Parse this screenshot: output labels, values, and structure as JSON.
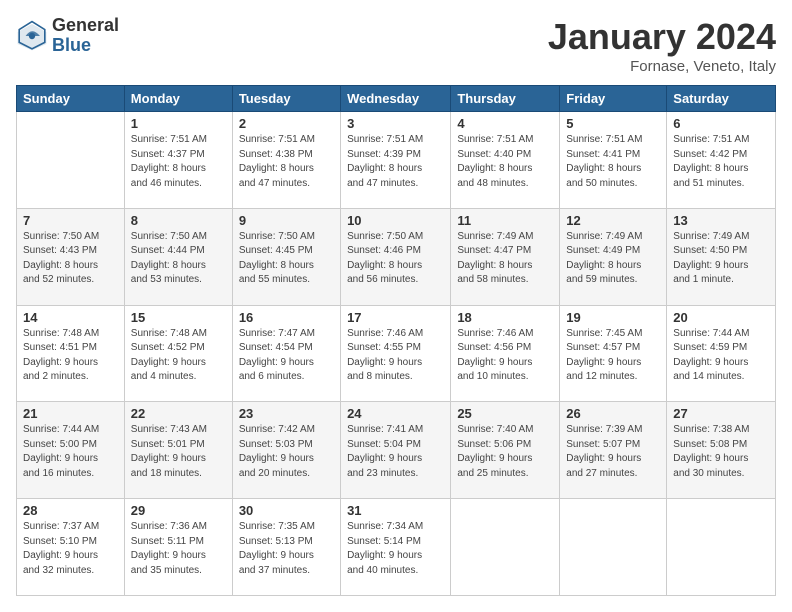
{
  "logo": {
    "general": "General",
    "blue": "Blue"
  },
  "title": "January 2024",
  "subtitle": "Fornase, Veneto, Italy",
  "header_days": [
    "Sunday",
    "Monday",
    "Tuesday",
    "Wednesday",
    "Thursday",
    "Friday",
    "Saturday"
  ],
  "weeks": [
    [
      {
        "day": "",
        "info": ""
      },
      {
        "day": "1",
        "info": "Sunrise: 7:51 AM\nSunset: 4:37 PM\nDaylight: 8 hours\nand 46 minutes."
      },
      {
        "day": "2",
        "info": "Sunrise: 7:51 AM\nSunset: 4:38 PM\nDaylight: 8 hours\nand 47 minutes."
      },
      {
        "day": "3",
        "info": "Sunrise: 7:51 AM\nSunset: 4:39 PM\nDaylight: 8 hours\nand 47 minutes."
      },
      {
        "day": "4",
        "info": "Sunrise: 7:51 AM\nSunset: 4:40 PM\nDaylight: 8 hours\nand 48 minutes."
      },
      {
        "day": "5",
        "info": "Sunrise: 7:51 AM\nSunset: 4:41 PM\nDaylight: 8 hours\nand 50 minutes."
      },
      {
        "day": "6",
        "info": "Sunrise: 7:51 AM\nSunset: 4:42 PM\nDaylight: 8 hours\nand 51 minutes."
      }
    ],
    [
      {
        "day": "7",
        "info": "Sunrise: 7:50 AM\nSunset: 4:43 PM\nDaylight: 8 hours\nand 52 minutes."
      },
      {
        "day": "8",
        "info": "Sunrise: 7:50 AM\nSunset: 4:44 PM\nDaylight: 8 hours\nand 53 minutes."
      },
      {
        "day": "9",
        "info": "Sunrise: 7:50 AM\nSunset: 4:45 PM\nDaylight: 8 hours\nand 55 minutes."
      },
      {
        "day": "10",
        "info": "Sunrise: 7:50 AM\nSunset: 4:46 PM\nDaylight: 8 hours\nand 56 minutes."
      },
      {
        "day": "11",
        "info": "Sunrise: 7:49 AM\nSunset: 4:47 PM\nDaylight: 8 hours\nand 58 minutes."
      },
      {
        "day": "12",
        "info": "Sunrise: 7:49 AM\nSunset: 4:49 PM\nDaylight: 8 hours\nand 59 minutes."
      },
      {
        "day": "13",
        "info": "Sunrise: 7:49 AM\nSunset: 4:50 PM\nDaylight: 9 hours\nand 1 minute."
      }
    ],
    [
      {
        "day": "14",
        "info": "Sunrise: 7:48 AM\nSunset: 4:51 PM\nDaylight: 9 hours\nand 2 minutes."
      },
      {
        "day": "15",
        "info": "Sunrise: 7:48 AM\nSunset: 4:52 PM\nDaylight: 9 hours\nand 4 minutes."
      },
      {
        "day": "16",
        "info": "Sunrise: 7:47 AM\nSunset: 4:54 PM\nDaylight: 9 hours\nand 6 minutes."
      },
      {
        "day": "17",
        "info": "Sunrise: 7:46 AM\nSunset: 4:55 PM\nDaylight: 9 hours\nand 8 minutes."
      },
      {
        "day": "18",
        "info": "Sunrise: 7:46 AM\nSunset: 4:56 PM\nDaylight: 9 hours\nand 10 minutes."
      },
      {
        "day": "19",
        "info": "Sunrise: 7:45 AM\nSunset: 4:57 PM\nDaylight: 9 hours\nand 12 minutes."
      },
      {
        "day": "20",
        "info": "Sunrise: 7:44 AM\nSunset: 4:59 PM\nDaylight: 9 hours\nand 14 minutes."
      }
    ],
    [
      {
        "day": "21",
        "info": "Sunrise: 7:44 AM\nSunset: 5:00 PM\nDaylight: 9 hours\nand 16 minutes."
      },
      {
        "day": "22",
        "info": "Sunrise: 7:43 AM\nSunset: 5:01 PM\nDaylight: 9 hours\nand 18 minutes."
      },
      {
        "day": "23",
        "info": "Sunrise: 7:42 AM\nSunset: 5:03 PM\nDaylight: 9 hours\nand 20 minutes."
      },
      {
        "day": "24",
        "info": "Sunrise: 7:41 AM\nSunset: 5:04 PM\nDaylight: 9 hours\nand 23 minutes."
      },
      {
        "day": "25",
        "info": "Sunrise: 7:40 AM\nSunset: 5:06 PM\nDaylight: 9 hours\nand 25 minutes."
      },
      {
        "day": "26",
        "info": "Sunrise: 7:39 AM\nSunset: 5:07 PM\nDaylight: 9 hours\nand 27 minutes."
      },
      {
        "day": "27",
        "info": "Sunrise: 7:38 AM\nSunset: 5:08 PM\nDaylight: 9 hours\nand 30 minutes."
      }
    ],
    [
      {
        "day": "28",
        "info": "Sunrise: 7:37 AM\nSunset: 5:10 PM\nDaylight: 9 hours\nand 32 minutes."
      },
      {
        "day": "29",
        "info": "Sunrise: 7:36 AM\nSunset: 5:11 PM\nDaylight: 9 hours\nand 35 minutes."
      },
      {
        "day": "30",
        "info": "Sunrise: 7:35 AM\nSunset: 5:13 PM\nDaylight: 9 hours\nand 37 minutes."
      },
      {
        "day": "31",
        "info": "Sunrise: 7:34 AM\nSunset: 5:14 PM\nDaylight: 9 hours\nand 40 minutes."
      },
      {
        "day": "",
        "info": ""
      },
      {
        "day": "",
        "info": ""
      },
      {
        "day": "",
        "info": ""
      }
    ]
  ]
}
